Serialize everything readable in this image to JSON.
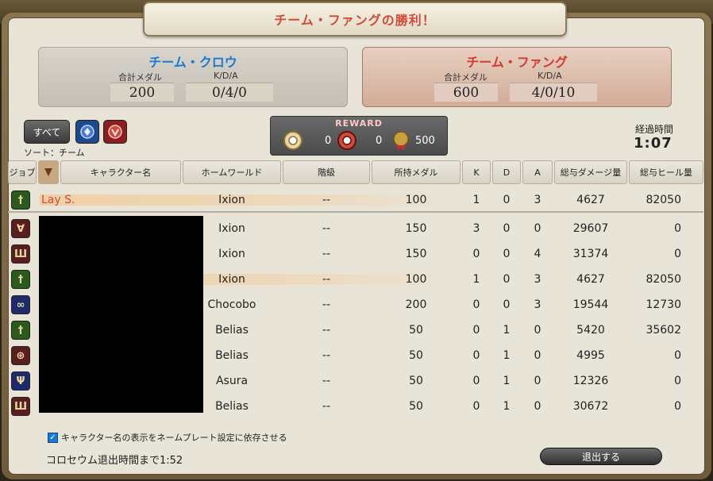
{
  "title": "チーム・ファングの勝利！",
  "teams": {
    "crow": {
      "name": "チーム・クロウ",
      "medal_label": "合計メダル",
      "kda_label": "K/D/A",
      "medals": "200",
      "kda": "0/4/0"
    },
    "fang": {
      "name": "チーム・ファング",
      "medal_label": "合計メダル",
      "kda_label": "K/D/A",
      "medals": "600",
      "kda": "4/0/10"
    }
  },
  "filters": {
    "all_label": "すべて",
    "sort_label": "ソート：チーム"
  },
  "reward": {
    "title": "REWARD",
    "item1": "0",
    "item2": "0",
    "item3": "500"
  },
  "elapsed": {
    "label": "経過時間",
    "value": "1:07"
  },
  "headers": [
    "ジョブ",
    "",
    "キャラクター名",
    "ホームワールド",
    "階級",
    "所持メダル",
    "K",
    "D",
    "A",
    "総与ダメージ量",
    "総与ヒール量"
  ],
  "self_row": {
    "job": "healer",
    "name": "Lay S.",
    "world": "Ixion",
    "rank": "--",
    "medals": "100",
    "k": "1",
    "d": "0",
    "a": "3",
    "dmg": "4627",
    "heal": "82050"
  },
  "rows": [
    {
      "job": "dps",
      "world": "Ixion",
      "rank": "--",
      "medals": "150",
      "k": "3",
      "d": "0",
      "a": "0",
      "dmg": "29607",
      "heal": "0"
    },
    {
      "job": "tank",
      "world": "Ixion",
      "rank": "--",
      "medals": "150",
      "k": "0",
      "d": "0",
      "a": "4",
      "dmg": "31374",
      "heal": "0"
    },
    {
      "job": "healer",
      "world": "Ixion",
      "rank": "--",
      "medals": "100",
      "k": "1",
      "d": "0",
      "a": "3",
      "dmg": "4627",
      "heal": "82050"
    },
    {
      "job": "tank",
      "world": "Chocobo",
      "rank": "--",
      "medals": "200",
      "k": "0",
      "d": "0",
      "a": "3",
      "dmg": "19544",
      "heal": "12730"
    },
    {
      "job": "healer",
      "world": "Belias",
      "rank": "--",
      "medals": "50",
      "k": "0",
      "d": "1",
      "a": "0",
      "dmg": "5420",
      "heal": "35602"
    },
    {
      "job": "dps",
      "world": "Belias",
      "rank": "--",
      "medals": "50",
      "k": "0",
      "d": "1",
      "a": "0",
      "dmg": "4995",
      "heal": "0"
    },
    {
      "job": "tank",
      "world": "Asura",
      "rank": "--",
      "medals": "50",
      "k": "0",
      "d": "1",
      "a": "0",
      "dmg": "12326",
      "heal": "0"
    },
    {
      "job": "tank",
      "world": "Belias",
      "rank": "--",
      "medals": "50",
      "k": "0",
      "d": "1",
      "a": "0",
      "dmg": "30672",
      "heal": "0"
    }
  ],
  "footer": {
    "checkbox_label": "キャラクター名の表示をネームプレート設定に依存させる",
    "time_left": "コロセウム退出時間まで1:52",
    "exit_label": "退出する"
  }
}
